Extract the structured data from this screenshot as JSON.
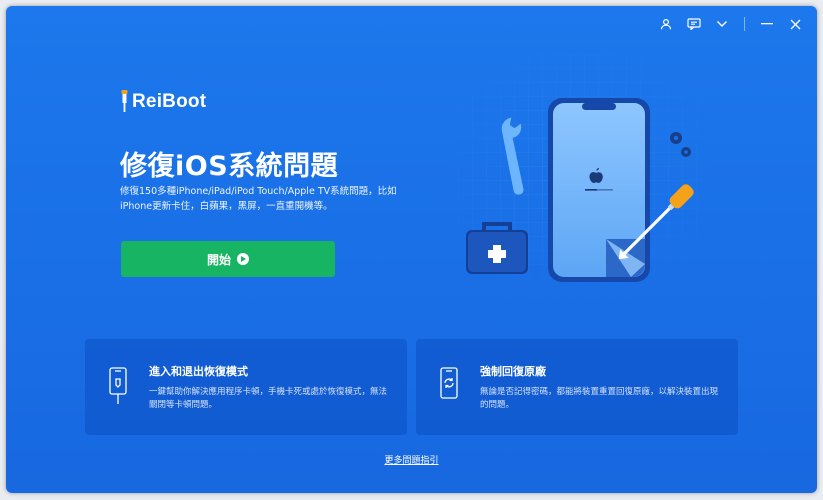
{
  "titlebar": {
    "icons": [
      "user-icon",
      "feedback-icon",
      "chevron-down-icon",
      "minimize-icon",
      "close-icon"
    ]
  },
  "brand": {
    "name": "ReiBoot"
  },
  "hero": {
    "title": "修復iOS系統問題",
    "description": "修復150多種iPhone/iPad/iPod Touch/Apple TV系統問題，比如iPhone更新卡住，白蘋果，黑屏，一直重開機等。",
    "start_label": "開始"
  },
  "cards": [
    {
      "title": "進入和退出恢復模式",
      "description": "一鍵幫助你解決應用程序卡頓，手機卡死或處於恢復模式，無法關閉等卡頓問題。",
      "icon": "phone-cable-icon"
    },
    {
      "title": "強制回復原廠",
      "description": "無論是否記得密碼，都能將裝置重置回復原廠，以解決裝置出現的問題。",
      "icon": "phone-reset-icon"
    }
  ],
  "footer": {
    "more_link": "更多問題指引"
  },
  "colors": {
    "background": "#1a6fe6",
    "start_button": "#17b463",
    "card": "#0848b9",
    "screwdriver": "#f5a21b"
  }
}
